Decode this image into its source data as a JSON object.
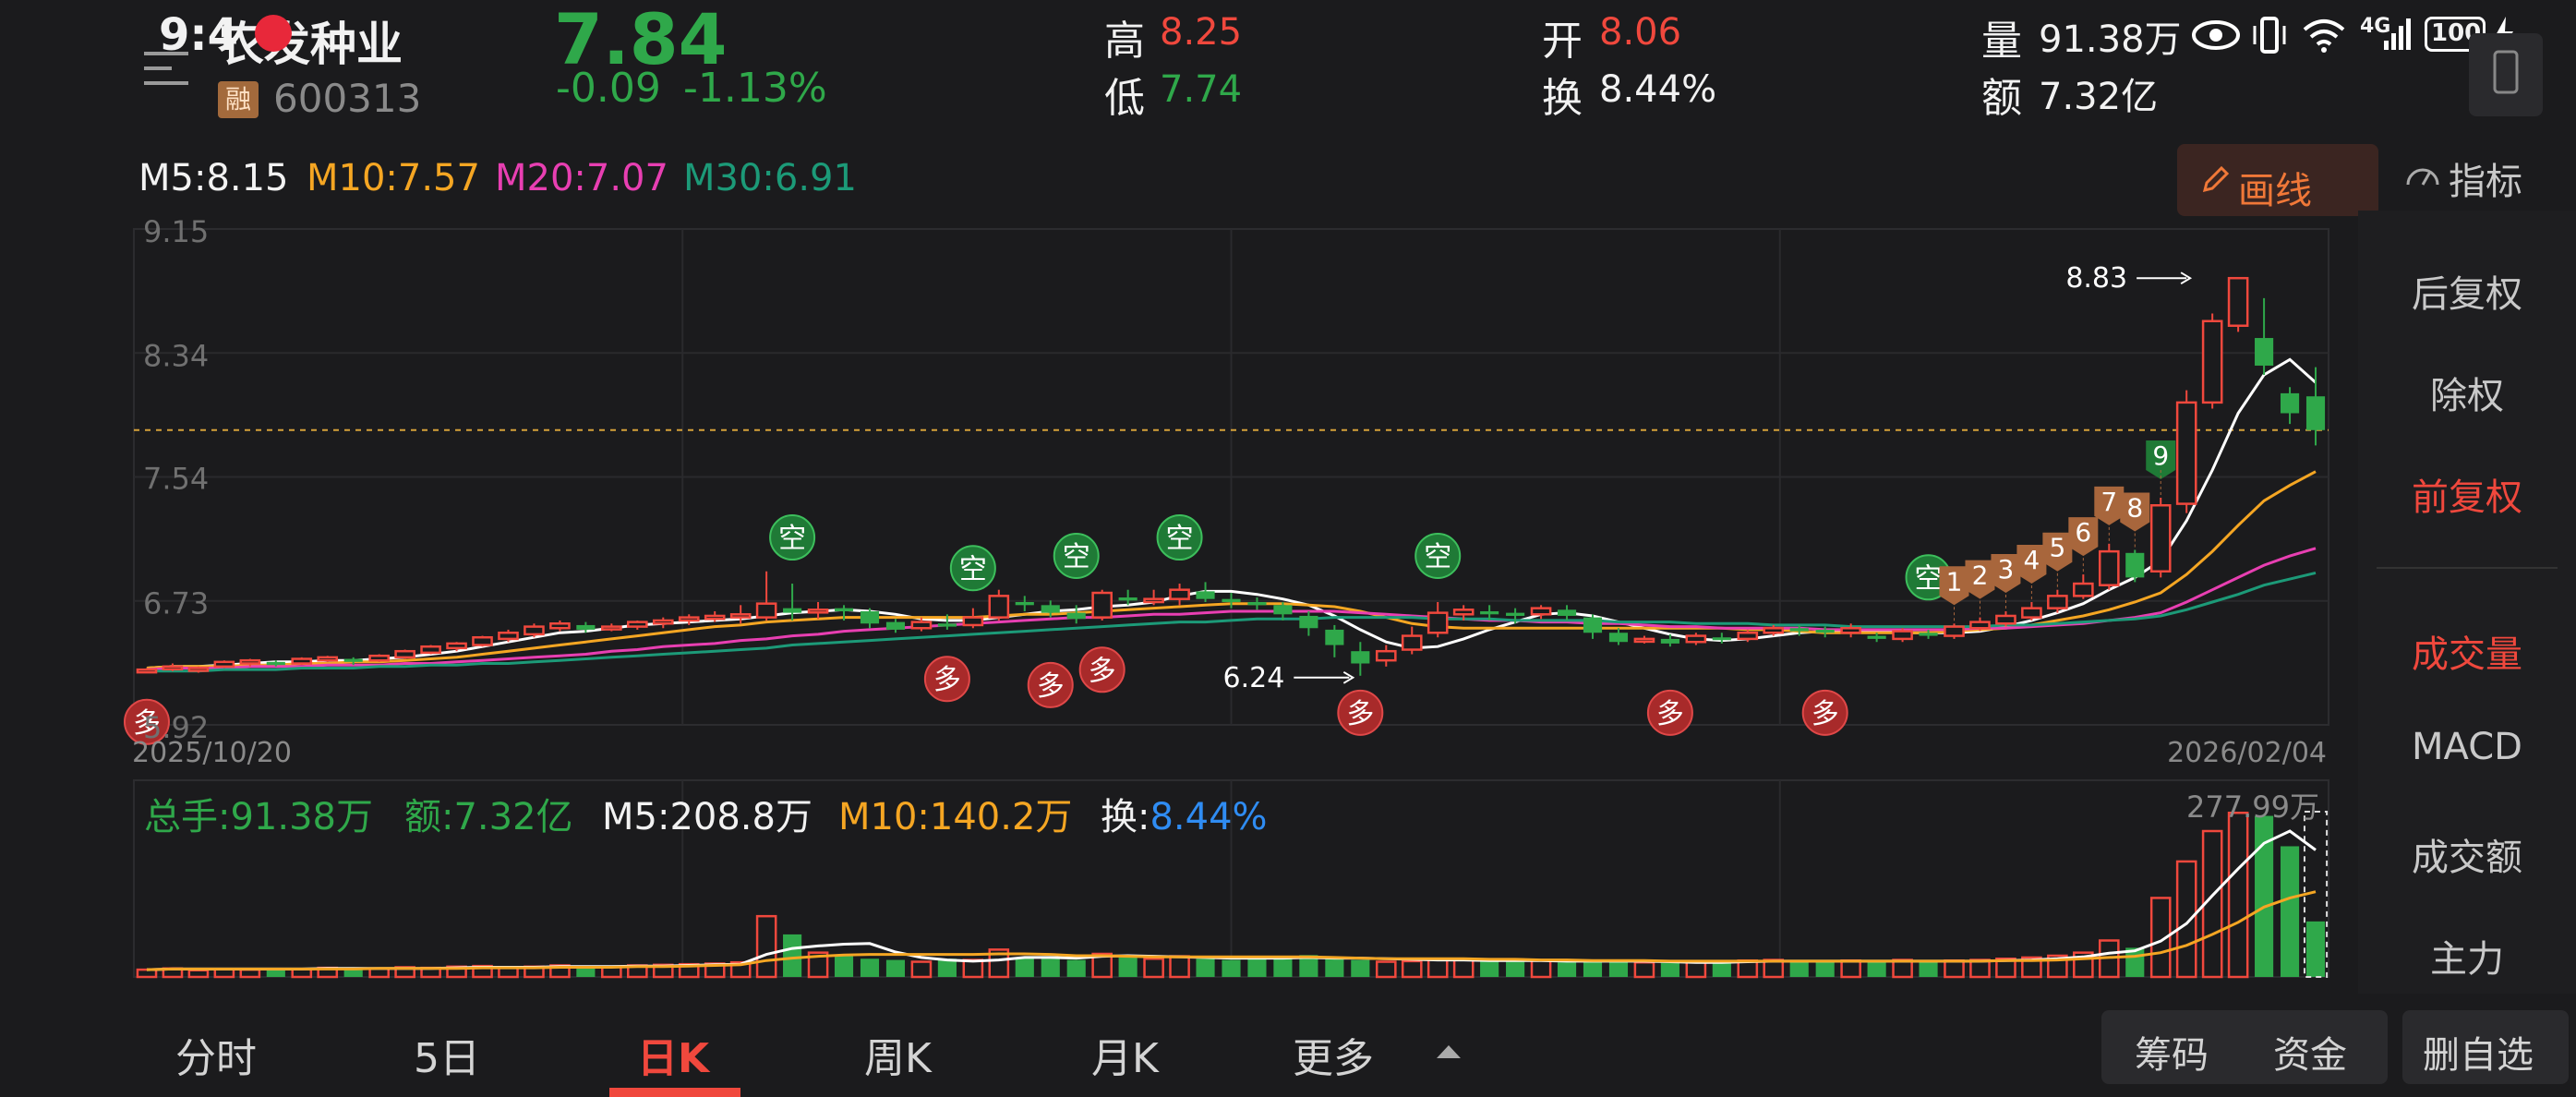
{
  "status_bar": {
    "time": "9:4",
    "network": "4G",
    "battery": "100"
  },
  "stock": {
    "name": "农发种业",
    "margin_badge": "融",
    "code": "600313",
    "price": "7.84",
    "change": "-0.09",
    "change_pct": "-1.13%",
    "high_label": "高",
    "high": "8.25",
    "low_label": "低",
    "low": "7.74",
    "open_label": "开",
    "open": "8.06",
    "turnover_label": "换",
    "turnover": "8.44%",
    "volume_label": "量",
    "volume": "91.38万",
    "amount_label": "额",
    "amount": "7.32亿"
  },
  "ma_legend": {
    "m5": "M5:8.15",
    "m10": "M10:7.57",
    "m20": "M20:7.07",
    "m30": "M30:6.91"
  },
  "draw_button": "画线",
  "indicator_button": "指标",
  "sidebar": {
    "items": [
      "后复权",
      "除权",
      "前复权",
      "成交量",
      "MACD",
      "成交额",
      "主力"
    ],
    "active": [
      "前复权",
      "成交量"
    ]
  },
  "chart_data": {
    "type": "candlestick",
    "y_ticks": [
      "9.15",
      "8.34",
      "7.54",
      "6.73",
      "5.92"
    ],
    "ylim": [
      5.92,
      9.15
    ],
    "x_start": "2025/10/20",
    "x_end": "2026/02/04",
    "current_price": 7.84,
    "annotations": {
      "high_label": "8.83",
      "low_label": "6.24"
    },
    "signals": [
      "空",
      "多"
    ],
    "sequence_labels": [
      "1",
      "2",
      "3",
      "4",
      "5",
      "6",
      "7",
      "8",
      "9"
    ],
    "candles": [
      [
        6.28,
        6.28,
        6.28,
        6.29
      ],
      [
        6.29,
        6.3,
        6.27,
        6.32
      ],
      [
        6.28,
        6.29,
        6.26,
        6.3
      ],
      [
        6.3,
        6.33,
        6.29,
        6.34
      ],
      [
        6.32,
        6.34,
        6.3,
        6.35
      ],
      [
        6.33,
        6.31,
        6.3,
        6.34
      ],
      [
        6.32,
        6.35,
        6.31,
        6.36
      ],
      [
        6.34,
        6.36,
        6.33,
        6.37
      ],
      [
        6.35,
        6.33,
        6.31,
        6.36
      ],
      [
        6.34,
        6.37,
        6.33,
        6.38
      ],
      [
        6.36,
        6.4,
        6.35,
        6.41
      ],
      [
        6.39,
        6.43,
        6.38,
        6.44
      ],
      [
        6.42,
        6.45,
        6.4,
        6.46
      ],
      [
        6.44,
        6.49,
        6.43,
        6.5
      ],
      [
        6.48,
        6.52,
        6.46,
        6.54
      ],
      [
        6.51,
        6.56,
        6.49,
        6.58
      ],
      [
        6.55,
        6.58,
        6.53,
        6.6
      ],
      [
        6.57,
        6.54,
        6.52,
        6.59
      ],
      [
        6.55,
        6.56,
        6.53,
        6.58
      ],
      [
        6.56,
        6.59,
        6.54,
        6.6
      ],
      [
        6.58,
        6.6,
        6.55,
        6.62
      ],
      [
        6.6,
        6.62,
        6.57,
        6.64
      ],
      [
        6.61,
        6.63,
        6.59,
        6.66
      ],
      [
        6.62,
        6.64,
        6.58,
        6.7
      ],
      [
        6.62,
        6.71,
        6.6,
        6.92
      ],
      [
        6.68,
        6.65,
        6.6,
        6.84
      ],
      [
        6.66,
        6.67,
        6.61,
        6.72
      ],
      [
        6.68,
        6.66,
        6.6,
        6.7
      ],
      [
        6.66,
        6.58,
        6.55,
        6.68
      ],
      [
        6.59,
        6.54,
        6.52,
        6.61
      ],
      [
        6.55,
        6.59,
        6.53,
        6.62
      ],
      [
        6.58,
        6.56,
        6.54,
        6.64
      ],
      [
        6.57,
        6.62,
        6.55,
        6.68
      ],
      [
        6.62,
        6.76,
        6.6,
        6.8
      ],
      [
        6.72,
        6.7,
        6.66,
        6.76
      ],
      [
        6.7,
        6.65,
        6.62,
        6.73
      ],
      [
        6.65,
        6.61,
        6.58,
        6.7
      ],
      [
        6.62,
        6.78,
        6.6,
        6.8
      ],
      [
        6.75,
        6.73,
        6.7,
        6.8
      ],
      [
        6.72,
        6.74,
        6.7,
        6.8
      ],
      [
        6.74,
        6.8,
        6.7,
        6.84
      ],
      [
        6.79,
        6.74,
        6.72,
        6.85
      ],
      [
        6.74,
        6.72,
        6.68,
        6.78
      ],
      [
        6.72,
        6.7,
        6.67,
        6.75
      ],
      [
        6.7,
        6.64,
        6.6,
        6.72
      ],
      [
        6.63,
        6.55,
        6.5,
        6.66
      ],
      [
        6.54,
        6.44,
        6.36,
        6.57
      ],
      [
        6.4,
        6.32,
        6.24,
        6.46
      ],
      [
        6.34,
        6.4,
        6.3,
        6.44
      ],
      [
        6.41,
        6.5,
        6.38,
        6.56
      ],
      [
        6.52,
        6.65,
        6.49,
        6.72
      ],
      [
        6.64,
        6.67,
        6.6,
        6.7
      ],
      [
        6.66,
        6.64,
        6.6,
        6.7
      ],
      [
        6.65,
        6.63,
        6.58,
        6.68
      ],
      [
        6.64,
        6.68,
        6.61,
        6.7
      ],
      [
        6.67,
        6.63,
        6.6,
        6.7
      ],
      [
        6.62,
        6.52,
        6.48,
        6.64
      ],
      [
        6.52,
        6.46,
        6.44,
        6.55
      ],
      [
        6.47,
        6.48,
        6.45,
        6.5
      ],
      [
        6.48,
        6.45,
        6.43,
        6.51
      ],
      [
        6.46,
        6.5,
        6.44,
        6.52
      ],
      [
        6.49,
        6.48,
        6.45,
        6.52
      ],
      [
        6.48,
        6.52,
        6.46,
        6.54
      ],
      [
        6.52,
        6.55,
        6.5,
        6.57
      ],
      [
        6.55,
        6.53,
        6.5,
        6.57
      ],
      [
        6.54,
        6.52,
        6.49,
        6.56
      ],
      [
        6.52,
        6.55,
        6.49,
        6.58
      ],
      [
        6.5,
        6.48,
        6.46,
        6.52
      ],
      [
        6.48,
        6.53,
        6.46,
        6.55
      ],
      [
        6.52,
        6.5,
        6.48,
        6.54
      ],
      [
        6.5,
        6.56,
        6.48,
        6.58
      ],
      [
        6.55,
        6.59,
        6.53,
        6.62
      ],
      [
        6.58,
        6.63,
        6.56,
        6.66
      ],
      [
        6.62,
        6.68,
        6.6,
        6.72
      ],
      [
        6.68,
        6.76,
        6.65,
        6.8
      ],
      [
        6.76,
        6.84,
        6.74,
        6.9
      ],
      [
        6.83,
        7.05,
        6.8,
        7.1
      ],
      [
        7.04,
        6.88,
        6.85,
        7.06
      ],
      [
        6.92,
        7.35,
        6.88,
        7.4
      ],
      [
        7.36,
        8.02,
        7.3,
        8.1
      ],
      [
        8.02,
        8.55,
        7.98,
        8.6
      ],
      [
        8.52,
        8.83,
        8.48,
        8.83
      ],
      [
        8.44,
        8.26,
        8.2,
        8.7
      ],
      [
        8.08,
        7.95,
        7.88,
        8.12
      ],
      [
        8.06,
        7.84,
        7.74,
        8.25
      ]
    ],
    "ma": {
      "M5": [
        6.29,
        6.3,
        6.3,
        6.31,
        6.32,
        6.33,
        6.33,
        6.34,
        6.34,
        6.35,
        6.36,
        6.38,
        6.4,
        6.43,
        6.46,
        6.49,
        6.52,
        6.53,
        6.55,
        6.57,
        6.58,
        6.59,
        6.6,
        6.61,
        6.63,
        6.65,
        6.66,
        6.67,
        6.66,
        6.64,
        6.61,
        6.6,
        6.6,
        6.62,
        6.64,
        6.66,
        6.67,
        6.69,
        6.7,
        6.72,
        6.76,
        6.79,
        6.79,
        6.77,
        6.74,
        6.7,
        6.63,
        6.54,
        6.46,
        6.42,
        6.43,
        6.48,
        6.54,
        6.59,
        6.64,
        6.65,
        6.63,
        6.59,
        6.55,
        6.51,
        6.48,
        6.47,
        6.48,
        6.5,
        6.52,
        6.53,
        6.53,
        6.53,
        6.52,
        6.52,
        6.52,
        6.53,
        6.56,
        6.6,
        6.65,
        6.71,
        6.8,
        6.88,
        6.99,
        7.25,
        7.58,
        7.95,
        8.2,
        8.3,
        8.15
      ],
      "M10": [
        6.29,
        6.3,
        6.3,
        6.3,
        6.31,
        6.31,
        6.32,
        6.32,
        6.33,
        6.33,
        6.34,
        6.35,
        6.36,
        6.38,
        6.4,
        6.42,
        6.44,
        6.46,
        6.48,
        6.5,
        6.52,
        6.54,
        6.56,
        6.57,
        6.59,
        6.6,
        6.61,
        6.62,
        6.62,
        6.62,
        6.62,
        6.62,
        6.62,
        6.63,
        6.64,
        6.64,
        6.65,
        6.66,
        6.67,
        6.68,
        6.69,
        6.7,
        6.71,
        6.71,
        6.71,
        6.7,
        6.69,
        6.66,
        6.62,
        6.58,
        6.56,
        6.55,
        6.55,
        6.55,
        6.55,
        6.55,
        6.55,
        6.55,
        6.55,
        6.55,
        6.55,
        6.55,
        6.54,
        6.54,
        6.53,
        6.52,
        6.52,
        6.52,
        6.52,
        6.52,
        6.53,
        6.54,
        6.55,
        6.57,
        6.6,
        6.63,
        6.67,
        6.72,
        6.78,
        6.9,
        7.05,
        7.22,
        7.38,
        7.48,
        7.57
      ],
      "M20": [
        6.28,
        6.29,
        6.29,
        6.29,
        6.3,
        6.3,
        6.3,
        6.31,
        6.31,
        6.31,
        6.32,
        6.32,
        6.33,
        6.34,
        6.35,
        6.36,
        6.37,
        6.38,
        6.4,
        6.41,
        6.43,
        6.44,
        6.45,
        6.47,
        6.48,
        6.5,
        6.51,
        6.53,
        6.54,
        6.55,
        6.56,
        6.57,
        6.58,
        6.59,
        6.6,
        6.61,
        6.62,
        6.62,
        6.63,
        6.64,
        6.64,
        6.65,
        6.66,
        6.66,
        6.66,
        6.66,
        6.66,
        6.65,
        6.64,
        6.63,
        6.62,
        6.61,
        6.6,
        6.6,
        6.59,
        6.59,
        6.58,
        6.58,
        6.57,
        6.56,
        6.56,
        6.55,
        6.55,
        6.55,
        6.55,
        6.54,
        6.54,
        6.54,
        6.54,
        6.54,
        6.54,
        6.55,
        6.55,
        6.56,
        6.57,
        6.58,
        6.6,
        6.62,
        6.65,
        6.72,
        6.8,
        6.88,
        6.96,
        7.02,
        7.07
      ],
      "M30": [
        6.27,
        6.27,
        6.27,
        6.28,
        6.28,
        6.28,
        6.29,
        6.29,
        6.29,
        6.3,
        6.3,
        6.31,
        6.31,
        6.32,
        6.32,
        6.33,
        6.34,
        6.35,
        6.36,
        6.37,
        6.38,
        6.39,
        6.4,
        6.41,
        6.42,
        6.44,
        6.45,
        6.46,
        6.47,
        6.48,
        6.49,
        6.5,
        6.51,
        6.52,
        6.53,
        6.54,
        6.55,
        6.56,
        6.57,
        6.58,
        6.59,
        6.59,
        6.6,
        6.61,
        6.61,
        6.61,
        6.62,
        6.62,
        6.62,
        6.62,
        6.61,
        6.61,
        6.61,
        6.6,
        6.6,
        6.6,
        6.6,
        6.59,
        6.59,
        6.59,
        6.58,
        6.58,
        6.58,
        6.57,
        6.57,
        6.57,
        6.56,
        6.56,
        6.56,
        6.56,
        6.56,
        6.56,
        6.57,
        6.57,
        6.58,
        6.59,
        6.6,
        6.61,
        6.63,
        6.67,
        6.72,
        6.77,
        6.83,
        6.87,
        6.91
      ]
    },
    "volume": {
      "legend_total_label": "总手:",
      "total": "91.38万",
      "legend_amount_label": "额:",
      "amount": "7.32亿",
      "m5": "M5:208.8万",
      "m10": "M10:140.2万",
      "turnover_label": "换:",
      "turnover": "8.44%",
      "max_label": "277.99万",
      "ylim": [
        0,
        277.99
      ],
      "values": [
        12,
        14,
        11,
        13,
        12,
        14,
        13,
        15,
        12,
        14,
        16,
        15,
        17,
        18,
        16,
        17,
        19,
        18,
        17,
        19,
        20,
        21,
        22,
        24,
        100,
        70,
        40,
        35,
        30,
        28,
        25,
        30,
        28,
        45,
        32,
        30,
        28,
        38,
        32,
        30,
        34,
        30,
        28,
        30,
        33,
        36,
        30,
        28,
        25,
        26,
        30,
        28,
        26,
        25,
        27,
        24,
        28,
        26,
        24,
        23,
        26,
        25,
        27,
        28,
        26,
        25,
        27,
        25,
        28,
        26,
        27,
        28,
        30,
        32,
        35,
        40,
        60,
        48,
        130,
        190,
        240,
        270,
        265,
        215,
        91.38
      ],
      "ma5": [
        12,
        13,
        13,
        13,
        13,
        13,
        13,
        14,
        14,
        14,
        14,
        14,
        15,
        16,
        16,
        16,
        17,
        17,
        17,
        18,
        18,
        19,
        20,
        21,
        37,
        47,
        51,
        54,
        55,
        41,
        32,
        28,
        26,
        28,
        32,
        32,
        31,
        34,
        35,
        34,
        33,
        32,
        31,
        31,
        31,
        32,
        31,
        31,
        30,
        29,
        28,
        28,
        27,
        27,
        27,
        26,
        26,
        26,
        26,
        25,
        24,
        24,
        25,
        26,
        26,
        26,
        26,
        26,
        26,
        26,
        26,
        26,
        27,
        28,
        30,
        33,
        39,
        43,
        59,
        88,
        134,
        178,
        220,
        240,
        208.8
      ],
      "ma10": [
        12,
        13,
        13,
        13,
        13,
        13,
        13,
        13,
        13,
        14,
        14,
        14,
        14,
        15,
        15,
        15,
        16,
        16,
        16,
        17,
        17,
        18,
        19,
        20,
        27,
        31,
        34,
        36,
        37,
        37,
        37,
        37,
        37,
        38,
        38,
        37,
        35,
        35,
        34,
        33,
        33,
        33,
        33,
        33,
        33,
        33,
        32,
        31,
        30,
        30,
        30,
        30,
        29,
        29,
        28,
        28,
        27,
        27,
        27,
        26,
        26,
        26,
        26,
        26,
        26,
        26,
        26,
        26,
        26,
        26,
        26,
        26,
        27,
        27,
        28,
        30,
        32,
        34,
        40,
        52,
        70,
        90,
        115,
        130,
        140.2
      ]
    }
  },
  "tabs": [
    "分时",
    "5日",
    "日K",
    "周K",
    "月K",
    "更多"
  ],
  "active_tab": "日K",
  "right_buttons": [
    "筹码",
    "资金",
    "删自选"
  ]
}
